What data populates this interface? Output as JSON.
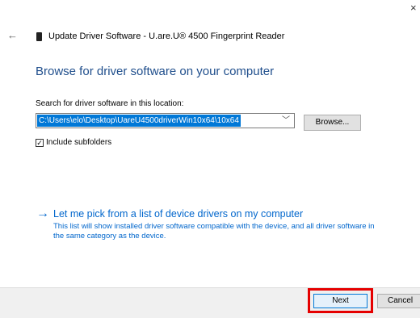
{
  "window": {
    "close_glyph": "×",
    "back_glyph": "←",
    "title": "Update Driver Software - U.are.U® 4500 Fingerprint Reader"
  },
  "main": {
    "heading": "Browse for driver software on your computer",
    "location_label": "Search for driver software in this location:",
    "path_value": "C:\\Users\\elo\\Desktop\\UareU4500driverWin10x64\\10x64",
    "browse_label": "Browse...",
    "include_subfolders": {
      "checked": true,
      "check_glyph": "✓",
      "label": "Include subfolders"
    },
    "pick_option": {
      "arrow_glyph": "→",
      "label": "Let me pick from a list of device drivers on my computer",
      "description": "This list will show installed driver software compatible with the device, and all driver software in the same category as the device."
    }
  },
  "footer": {
    "next_label": "Next",
    "cancel_label": "Cancel",
    "highlight_color": "#e50000"
  },
  "colors": {
    "heading": "#1f4e8c",
    "link": "#0066cc",
    "selection": "#0078d7"
  }
}
